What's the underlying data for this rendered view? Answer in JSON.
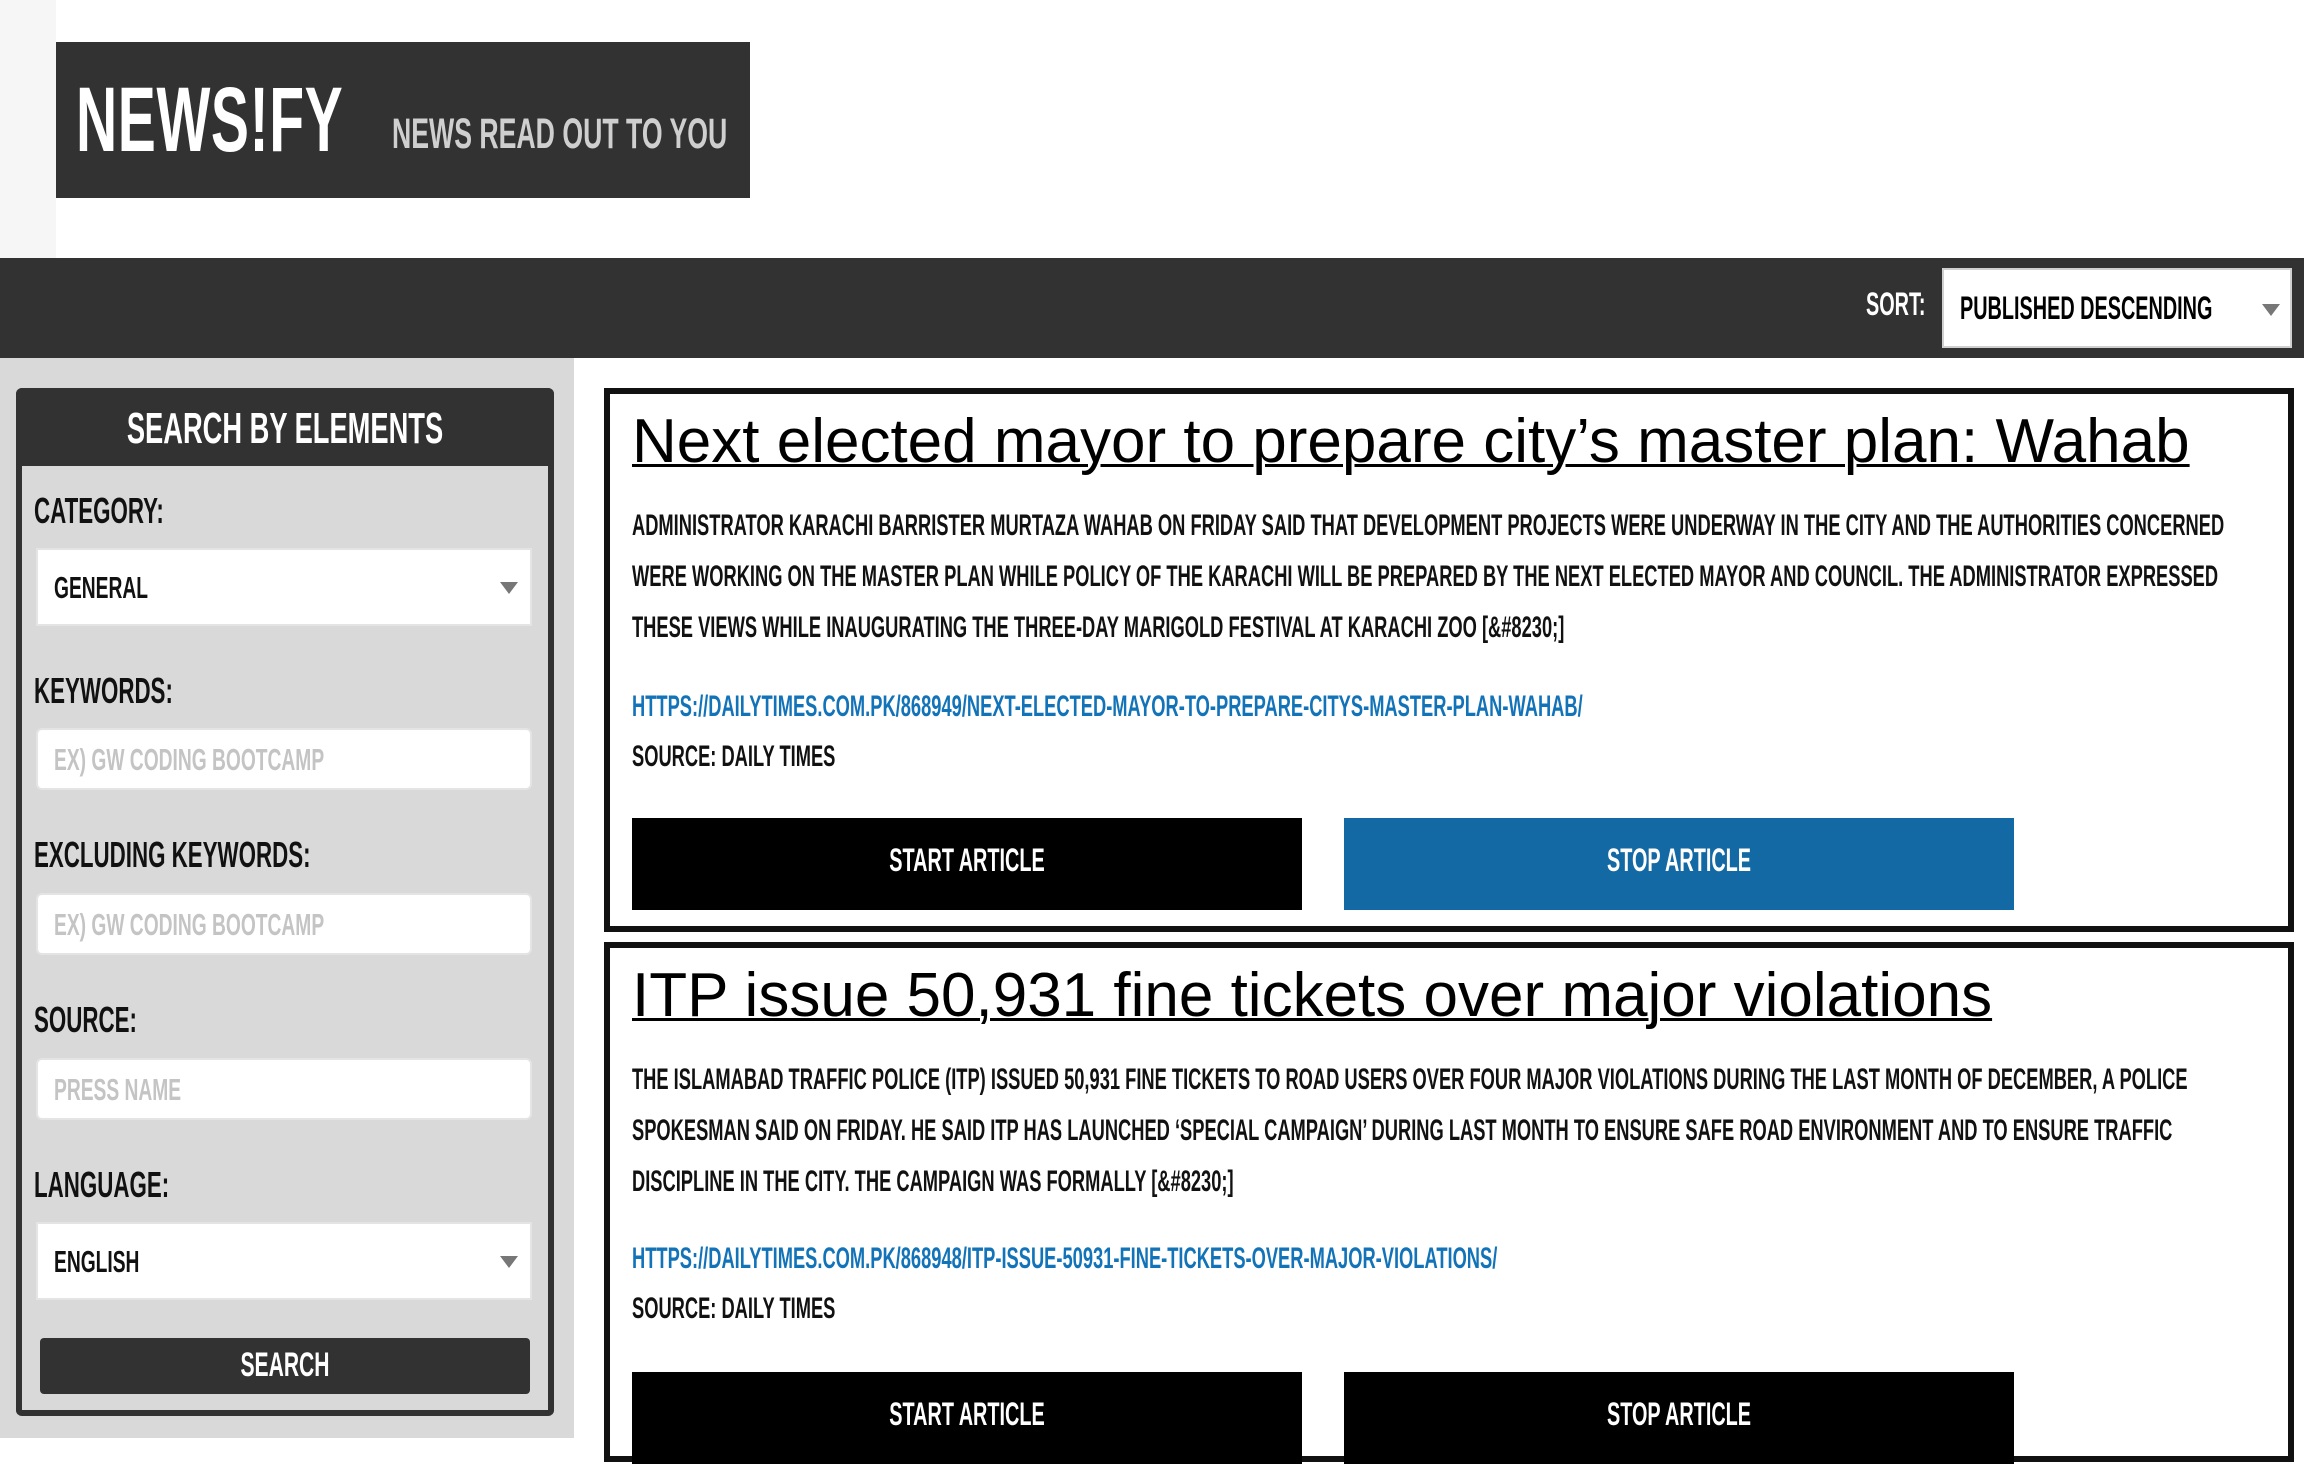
{
  "brand": {
    "name": "NEWS!FY",
    "tagline": "NEWS READ OUT TO YOU"
  },
  "toolbar": {
    "sort_label": "SORT:",
    "sort_value": "PUBLISHED DESCENDING"
  },
  "sidebar": {
    "title": "SEARCH BY ELEMENTS",
    "category": {
      "label": "CATEGORY:",
      "value": "GENERAL"
    },
    "keywords": {
      "label": "KEYWORDS:",
      "placeholder": "EX) GW CODING BOOTCAMP"
    },
    "excluding": {
      "label": "EXCLUDING KEYWORDS:",
      "placeholder": "EX) GW CODING BOOTCAMP"
    },
    "source": {
      "label": "SOURCE:",
      "placeholder": "PRESS NAME"
    },
    "language": {
      "label": "LANGUAGE:",
      "value": "ENGLISH"
    },
    "search_label": "SEARCH"
  },
  "articles": [
    {
      "title": "Next elected mayor to prepare city’s master plan: Wahab",
      "description": "ADMINISTRATOR KARACHI BARRISTER MURTAZA WAHAB ON FRIDAY SAID THAT DEVELOPMENT PROJECTS WERE UNDERWAY IN THE CITY AND THE AUTHORITIES CONCERNED WERE WORKING ON THE MASTER PLAN WHILE POLICY OF THE KARACHI WILL BE PREPARED BY THE NEXT ELECTED MAYOR AND COUNCIL. THE ADMINISTRATOR EXPRESSED THESE VIEWS WHILE INAUGURATING THE THREE-DAY MARIGOLD FESTIVAL AT KARACHI ZOO [&#8230;]",
      "url": "HTTPS://DAILYTIMES.COM.PK/868949/NEXT-ELECTED-MAYOR-TO-PREPARE-CITYS-MASTER-PLAN-WAHAB/",
      "source": "SOURCE: DAILY TIMES",
      "start_label": "START ARTICLE",
      "stop_label": "STOP ARTICLE"
    },
    {
      "title": "ITP issue 50,931 fine tickets over major violations",
      "description": "THE ISLAMABAD TRAFFIC POLICE (ITP) ISSUED 50,931 FINE TICKETS TO ROAD USERS OVER FOUR MAJOR VIOLATIONS DURING THE LAST MONTH OF DECEMBER, A POLICE SPOKESMAN SAID ON FRIDAY. HE SAID ITP HAS LAUNCHED ‘SPECIAL CAMPAIGN’ DURING LAST MONTH TO ENSURE SAFE ROAD ENVIRONMENT AND TO ENSURE TRAFFIC DISCIPLINE IN THE CITY. THE CAMPAIGN WAS FORMALLY [&#8230;]",
      "url": "HTTPS://DAILYTIMES.COM.PK/868948/ITP-ISSUE-50931-FINE-TICKETS-OVER-MAJOR-VIOLATIONS/",
      "source": "SOURCE: DAILY TIMES",
      "start_label": "START ARTICLE",
      "stop_label": "STOP ARTICLE"
    }
  ],
  "colors": {
    "dark": "#323232",
    "accent_blue": "#1369a3",
    "link_blue": "#1273b8",
    "panel_grey": "#d9d9d9"
  }
}
